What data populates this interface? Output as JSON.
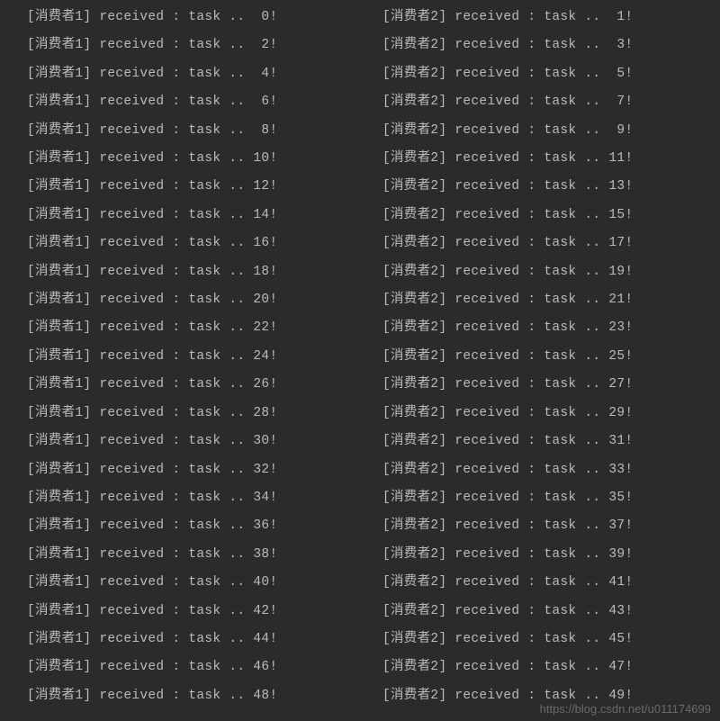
{
  "columns": {
    "left": {
      "consumer": "消费者1",
      "lines": [
        {
          "num": "0"
        },
        {
          "num": "2"
        },
        {
          "num": "4"
        },
        {
          "num": "6"
        },
        {
          "num": "8"
        },
        {
          "num": "10"
        },
        {
          "num": "12"
        },
        {
          "num": "14"
        },
        {
          "num": "16"
        },
        {
          "num": "18"
        },
        {
          "num": "20"
        },
        {
          "num": "22"
        },
        {
          "num": "24"
        },
        {
          "num": "26"
        },
        {
          "num": "28"
        },
        {
          "num": "30"
        },
        {
          "num": "32"
        },
        {
          "num": "34"
        },
        {
          "num": "36"
        },
        {
          "num": "38"
        },
        {
          "num": "40"
        },
        {
          "num": "42"
        },
        {
          "num": "44"
        },
        {
          "num": "46"
        },
        {
          "num": "48"
        }
      ]
    },
    "right": {
      "consumer": "消费者2",
      "lines": [
        {
          "num": "1"
        },
        {
          "num": "3"
        },
        {
          "num": "5"
        },
        {
          "num": "7"
        },
        {
          "num": "9"
        },
        {
          "num": "11"
        },
        {
          "num": "13"
        },
        {
          "num": "15"
        },
        {
          "num": "17"
        },
        {
          "num": "19"
        },
        {
          "num": "21"
        },
        {
          "num": "23"
        },
        {
          "num": "25"
        },
        {
          "num": "27"
        },
        {
          "num": "29"
        },
        {
          "num": "31"
        },
        {
          "num": "33"
        },
        {
          "num": "35"
        },
        {
          "num": "37"
        },
        {
          "num": "39"
        },
        {
          "num": "41"
        },
        {
          "num": "43"
        },
        {
          "num": "45"
        },
        {
          "num": "47"
        },
        {
          "num": "49"
        }
      ]
    }
  },
  "log_template": {
    "prefix": "[",
    "suffix": "]",
    "middle": " received : task .. ",
    "end": "!"
  },
  "watermark": "https://blog.csdn.net/u011174699"
}
